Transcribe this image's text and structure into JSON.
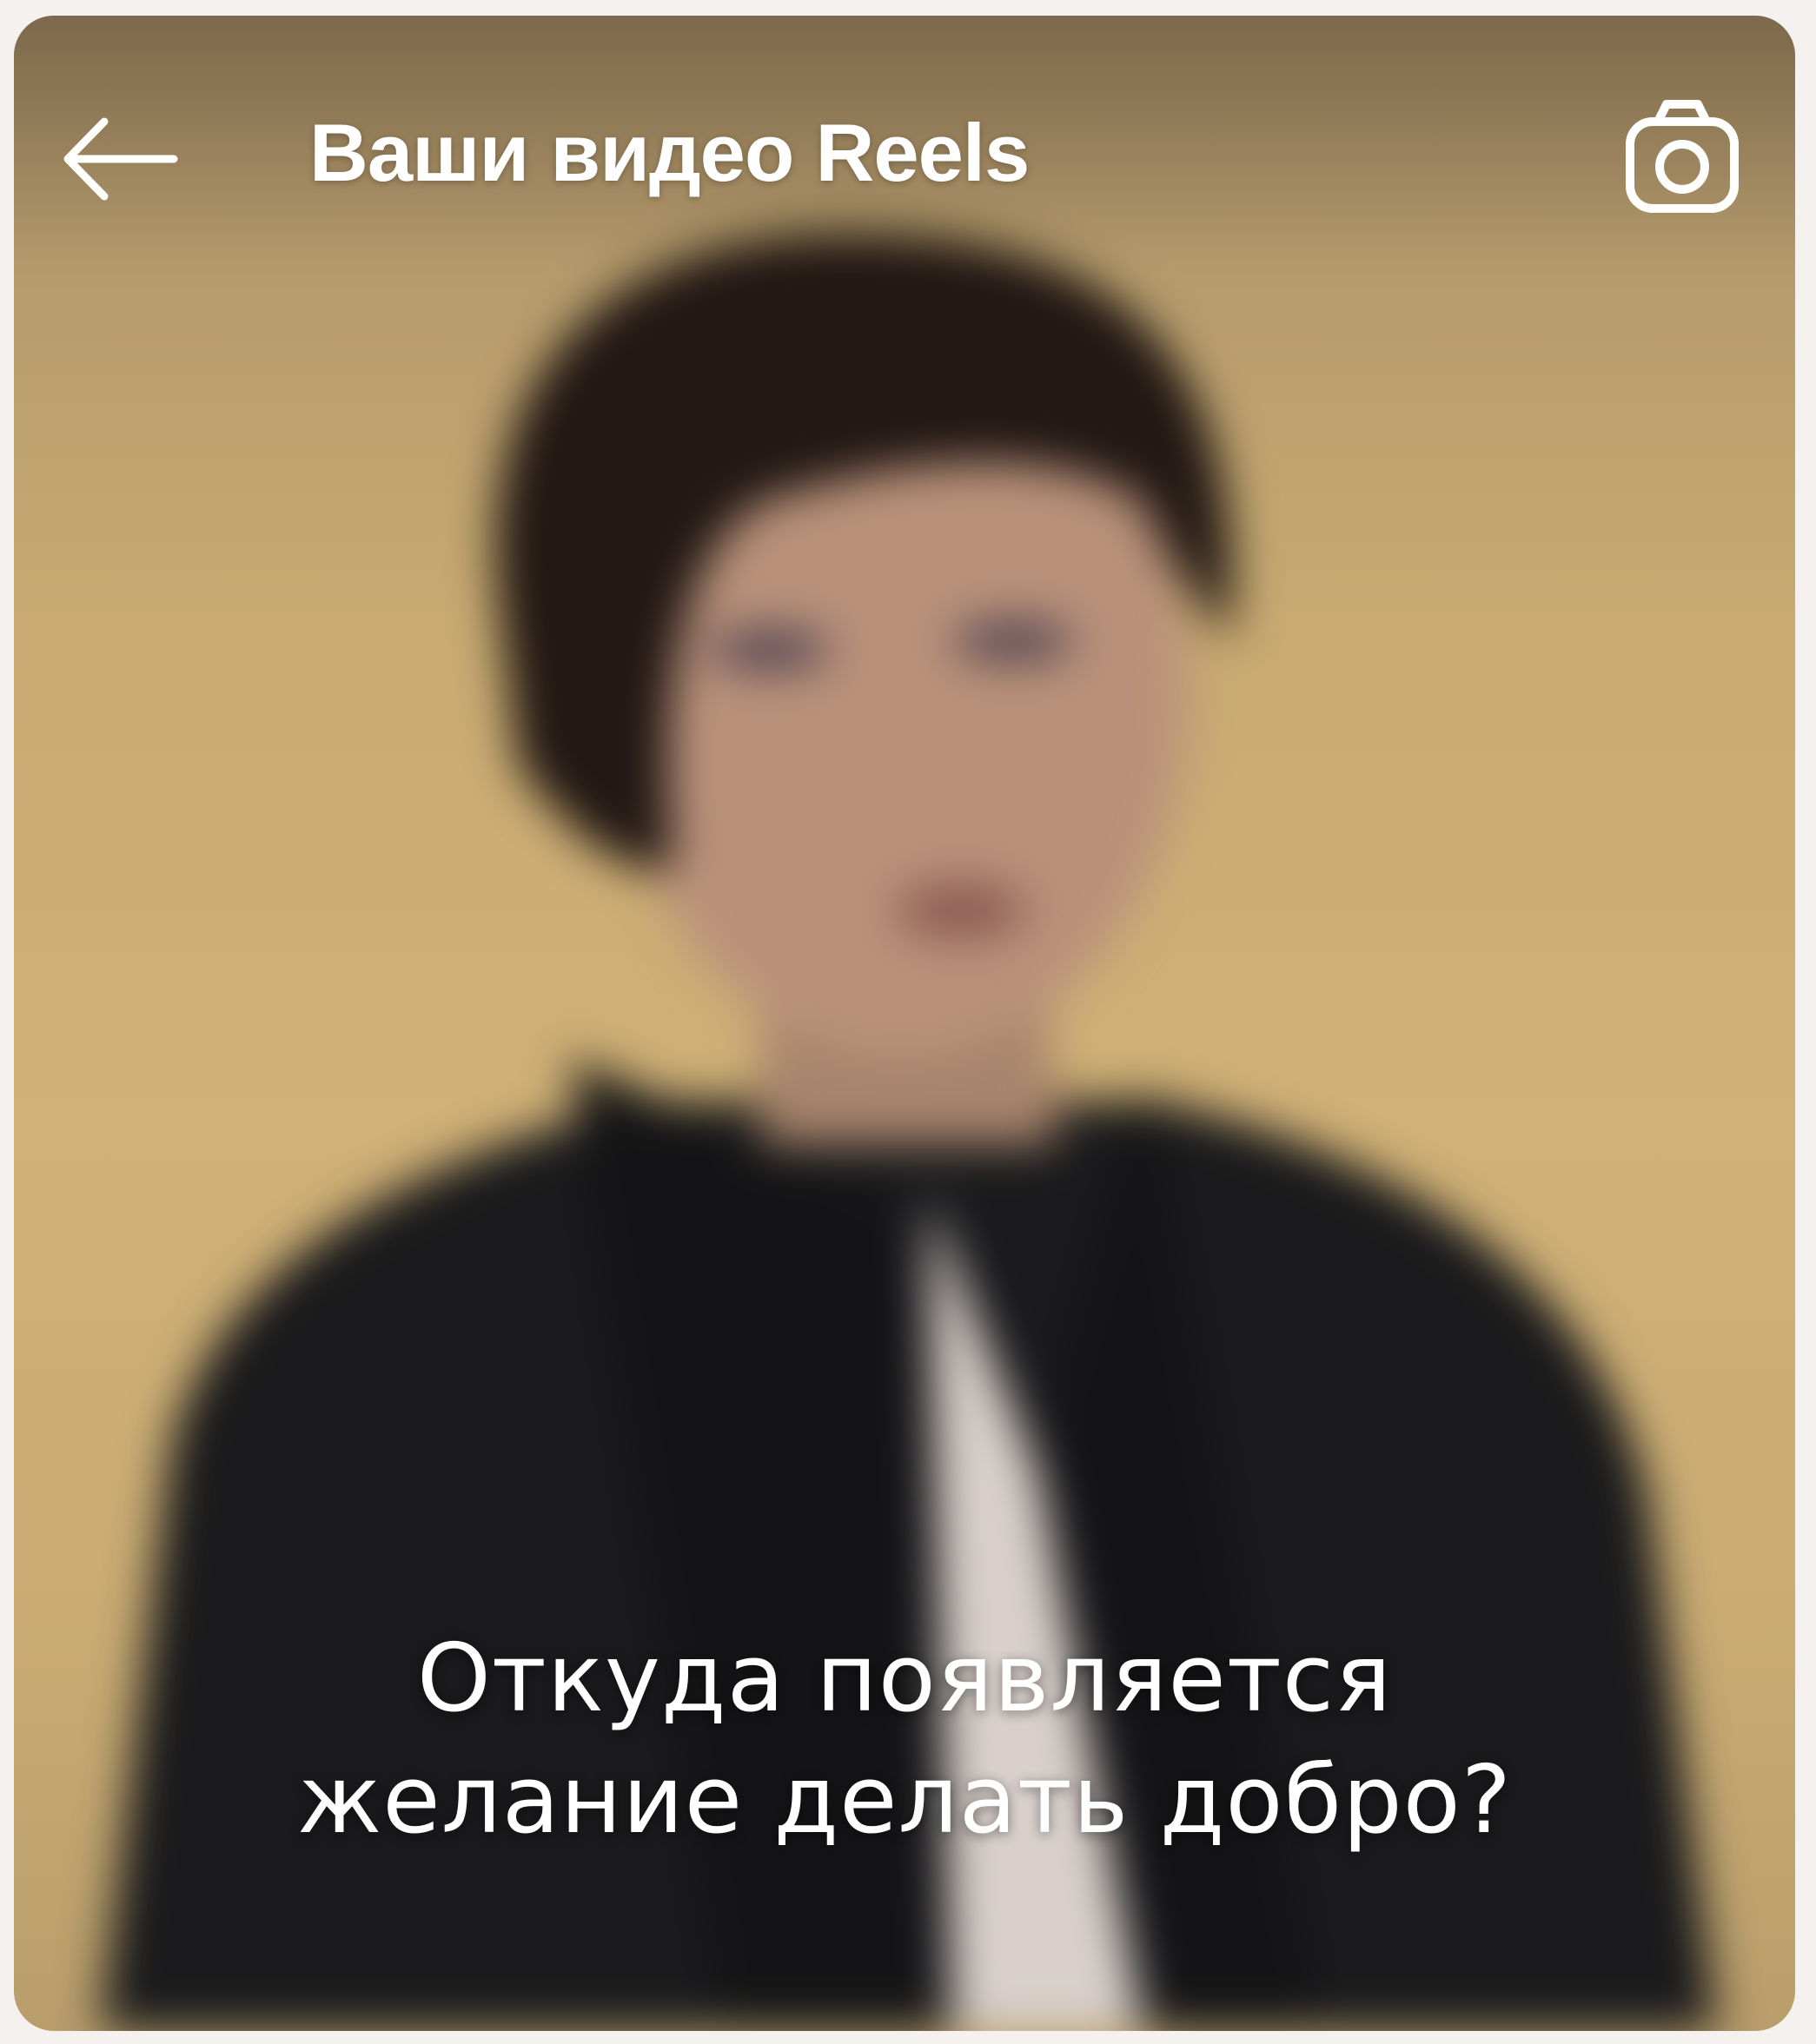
{
  "header": {
    "title": "Ваши видео Reels",
    "back_icon": "arrow-left-icon",
    "camera_icon": "camera-icon"
  },
  "video": {
    "caption_lines": [
      "Откуда появляется",
      "желание делать добро?"
    ],
    "blurred": true,
    "background_color": "#cfb176"
  },
  "colors": {
    "icon": "#ffffff",
    "text": "#ffffff",
    "page_bg": "#f4f1ee"
  }
}
